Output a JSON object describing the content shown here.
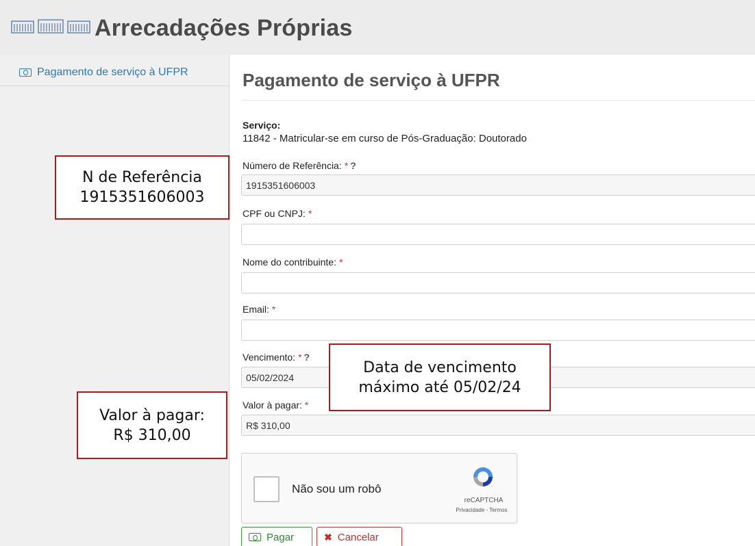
{
  "header": {
    "app_title": "Arrecadações Próprias",
    "logo_icon": "building-columns-logo"
  },
  "sidebar": {
    "items": [
      {
        "label": "Pagamento de serviço à UFPR",
        "icon": "cash-icon"
      }
    ]
  },
  "main": {
    "page_title": "Pagamento de serviço à UFPR",
    "service_label": "Serviço:",
    "service_value": "11842 - Matricular-se em curso de Pós-Graduação: Doutorado",
    "fields": {
      "reference": {
        "label": "Número de Referência:",
        "required": "*",
        "help": "?",
        "value": "1915351606003"
      },
      "cpf": {
        "label": "CPF ou CNPJ:",
        "required": "*",
        "value": ""
      },
      "name": {
        "label": "Nome do contribuinte:",
        "required": "*",
        "value": ""
      },
      "email": {
        "label": "Email:",
        "required": "*",
        "value": ""
      },
      "due_date": {
        "label": "Vencimento:",
        "required": "*",
        "help": "?",
        "value": "05/02/2024"
      },
      "amount": {
        "label": "Valor à pagar:",
        "required": "*",
        "value": "R$ 310,00"
      }
    },
    "captcha": {
      "checkbox_label": "Não sou um robô",
      "brand": "reCAPTCHA",
      "links": "Privacidade - Termos"
    },
    "buttons": {
      "pay": "Pagar",
      "cancel": "Cancelar"
    }
  },
  "annotations": {
    "reference": [
      "N de Referência",
      "1915351606003"
    ],
    "due_date": [
      "Data de vencimento",
      "máximo até 05/02/24"
    ],
    "amount": [
      "Valor à pagar:",
      "R$ 310,00"
    ]
  },
  "colors": {
    "link": "#2a7ab8",
    "callout_border": "#a61c1c",
    "required": "#d33333",
    "pay": "#2e8b2e",
    "cancel": "#c03030"
  }
}
